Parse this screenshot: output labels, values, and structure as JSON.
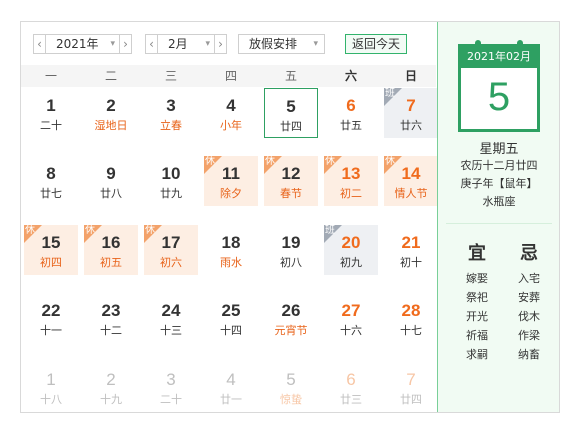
{
  "toolbar": {
    "prev": "‹",
    "next": "›",
    "arrow": "▾",
    "year_value": "2021年",
    "month_value": "2月",
    "holiday_value": "放假安排",
    "today_label": "返回今天"
  },
  "weekdays": [
    "一",
    "二",
    "三",
    "四",
    "五",
    "六",
    "日"
  ],
  "tags": {
    "rest": "休",
    "work": "班"
  },
  "colors": {
    "accent": "#2ea062",
    "weekend": "#f06b1d",
    "holiday_text": "#e8631a",
    "normal": "#333333",
    "dim": "#bfbfbf",
    "dim_weekend": "#f7c6a5"
  },
  "calendar": {
    "weeks": [
      [
        {
          "day": "1",
          "lunar": "二十"
        },
        {
          "day": "2",
          "lunar": "湿地日",
          "lunar_color": "holiday"
        },
        {
          "day": "3",
          "lunar": "立春",
          "lunar_color": "holiday"
        },
        {
          "day": "4",
          "lunar": "小年",
          "lunar_color": "holiday"
        },
        {
          "day": "5",
          "lunar": "廿四",
          "today": true
        },
        {
          "day": "6",
          "lunar": "廿五",
          "weekend": true
        },
        {
          "day": "7",
          "lunar": "廿六",
          "weekend": true,
          "status": "work"
        }
      ],
      [
        {
          "day": "8",
          "lunar": "廿七"
        },
        {
          "day": "9",
          "lunar": "廿八"
        },
        {
          "day": "10",
          "lunar": "廿九"
        },
        {
          "day": "11",
          "lunar": "除夕",
          "status": "rest",
          "lunar_color": "holiday"
        },
        {
          "day": "12",
          "lunar": "春节",
          "status": "rest",
          "lunar_color": "holiday"
        },
        {
          "day": "13",
          "lunar": "初二",
          "status": "rest",
          "weekend": true
        },
        {
          "day": "14",
          "lunar": "情人节",
          "status": "rest",
          "weekend": true,
          "lunar_color": "holiday"
        }
      ],
      [
        {
          "day": "15",
          "lunar": "初四",
          "status": "rest"
        },
        {
          "day": "16",
          "lunar": "初五",
          "status": "rest"
        },
        {
          "day": "17",
          "lunar": "初六",
          "status": "rest"
        },
        {
          "day": "18",
          "lunar": "雨水",
          "lunar_color": "holiday"
        },
        {
          "day": "19",
          "lunar": "初八"
        },
        {
          "day": "20",
          "lunar": "初九",
          "status": "work",
          "weekend": true
        },
        {
          "day": "21",
          "lunar": "初十",
          "weekend": true
        }
      ],
      [
        {
          "day": "22",
          "lunar": "十一"
        },
        {
          "day": "23",
          "lunar": "十二"
        },
        {
          "day": "24",
          "lunar": "十三"
        },
        {
          "day": "25",
          "lunar": "十四"
        },
        {
          "day": "26",
          "lunar": "元宵节",
          "lunar_color": "holiday"
        },
        {
          "day": "27",
          "lunar": "十六",
          "weekend": true
        },
        {
          "day": "28",
          "lunar": "十七",
          "weekend": true
        }
      ],
      [
        {
          "day": "1",
          "lunar": "十八",
          "other": true
        },
        {
          "day": "2",
          "lunar": "十九",
          "other": true
        },
        {
          "day": "3",
          "lunar": "二十",
          "other": true
        },
        {
          "day": "4",
          "lunar": "廿一",
          "other": true
        },
        {
          "day": "5",
          "lunar": "惊蛰",
          "other": true,
          "lunar_color": "holiday"
        },
        {
          "day": "6",
          "lunar": "廿三",
          "other": true,
          "weekend": true
        },
        {
          "day": "7",
          "lunar": "廿四",
          "other": true,
          "weekend": true
        }
      ]
    ]
  },
  "detail": {
    "card_header": "2021年02月",
    "day_number": "5",
    "weekday": "星期五",
    "lunar_date": "农历十二月廿四",
    "ganzhi": "庚子年【鼠年】",
    "constellation": "水瓶座",
    "yi_title": "宜",
    "ji_title": "忌",
    "yi": [
      "嫁娶",
      "祭祀",
      "开光",
      "祈福",
      "求嗣"
    ],
    "ji": [
      "入宅",
      "安葬",
      "伐木",
      "作梁",
      "纳畜"
    ]
  }
}
